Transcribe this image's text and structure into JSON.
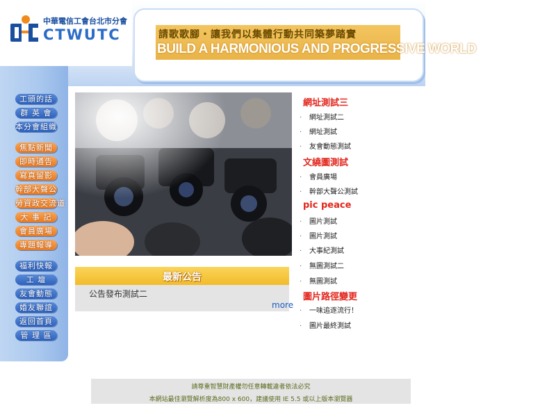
{
  "header": {
    "logo_cn": "中華電信工會台北市分會",
    "logo_en": "CTWUTC",
    "banner_cn": "請歌歌腳・讓我們以集體行動共同築夢踏實",
    "banner_en": "BUILD A HARMONIOUS AND PROGRESSIVE WORLD"
  },
  "nav": [
    {
      "label": "工頭的話",
      "color": "blue"
    },
    {
      "label": "群 英 會",
      "color": "blue"
    },
    {
      "label": "本分會組織",
      "color": "blue"
    },
    {
      "label": "焦點新聞",
      "color": "orange"
    },
    {
      "label": "即時通告",
      "color": "orange"
    },
    {
      "label": "寫真留影",
      "color": "orange"
    },
    {
      "label": "幹部大聲公",
      "color": "orange"
    },
    {
      "label": "勞資政交流道",
      "color": "orange"
    },
    {
      "label": "大 事 記",
      "color": "orange"
    },
    {
      "label": "會員廣場",
      "color": "orange"
    },
    {
      "label": "專題報導",
      "color": "orange"
    },
    {
      "label": "福利快報",
      "color": "blue"
    },
    {
      "label": "工 壇",
      "color": "blue"
    },
    {
      "label": "友會動態",
      "color": "blue"
    },
    {
      "label": "婚友聯誼",
      "color": "blue"
    },
    {
      "label": "返回首頁",
      "color": "blue"
    },
    {
      "label": "管 理 區",
      "color": "blue"
    }
  ],
  "announcement": {
    "title": "最新公告",
    "item": "公告發布測試二",
    "more": "more"
  },
  "sidebar": {
    "bullet": "·",
    "cat1": "網址測試三",
    "cat1_items": [
      "網址測試二",
      "網址測試",
      "友會動態測試"
    ],
    "cat2": "文繞圖測試",
    "cat2_items": [
      "會員廣場",
      "幹部大聲公測試"
    ],
    "cat3": "pic peace",
    "cat3_items": [
      "圖片測試",
      "圖片測試",
      "大事紀測試",
      "無圖測試二",
      "無圖測試"
    ],
    "cat4": "圖片路徑變更",
    "cat4_items": [
      "一味追逐流行！",
      "圖片最終測試"
    ]
  },
  "footer": {
    "line1": "請尊重智慧財產權勿任意轉載違者依法必究",
    "line2": "本網站最佳瀏覽解析度為800 x 600，建議使用 IE 5.5 或以上版本瀏覽器"
  },
  "colors": {
    "nav_blue": "#2e62bd",
    "nav_orange": "#ea7a1f",
    "category_red": "#e2261c",
    "banner_gold": "#f3c560"
  }
}
